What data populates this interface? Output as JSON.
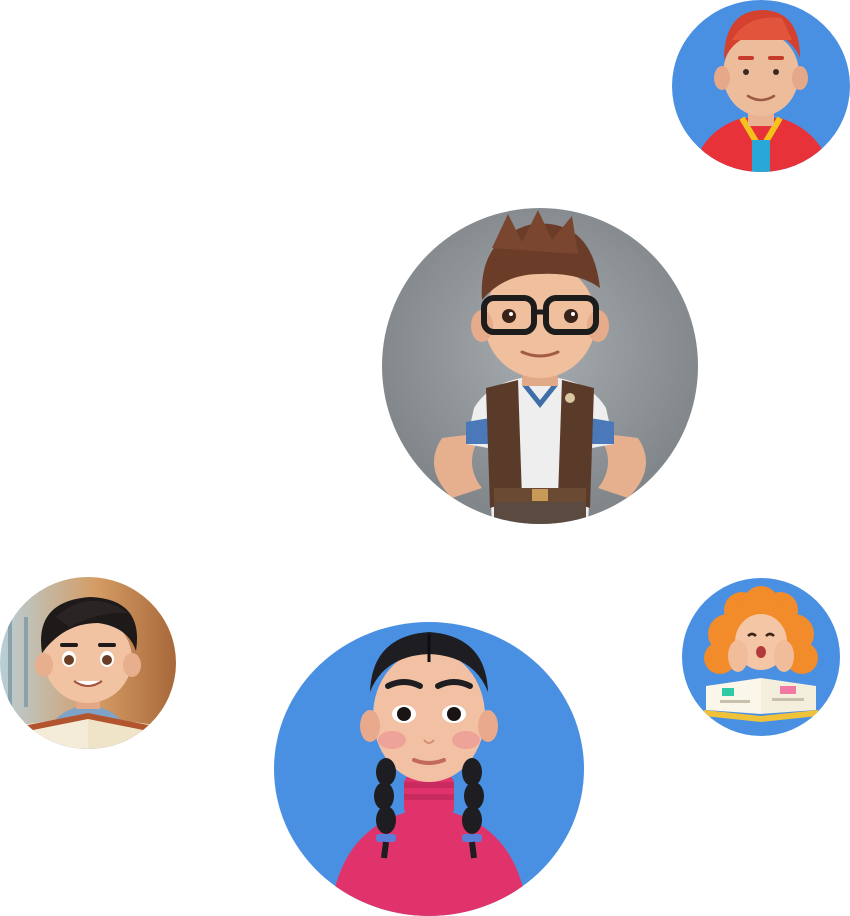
{
  "avatars": [
    {
      "id": "redhair",
      "icon": "avatar-redhair-boy",
      "background": "#4a90e2"
    },
    {
      "id": "glasses",
      "icon": "avatar-glasses-boy",
      "background": "#8a9096"
    },
    {
      "id": "reader",
      "icon": "avatar-reading-boy",
      "background": "#c98a52"
    },
    {
      "id": "braids",
      "icon": "avatar-braids-girl",
      "background": "#4a90e2"
    },
    {
      "id": "bookgirl",
      "icon": "avatar-book-girl",
      "background": "#4a90e2"
    }
  ]
}
